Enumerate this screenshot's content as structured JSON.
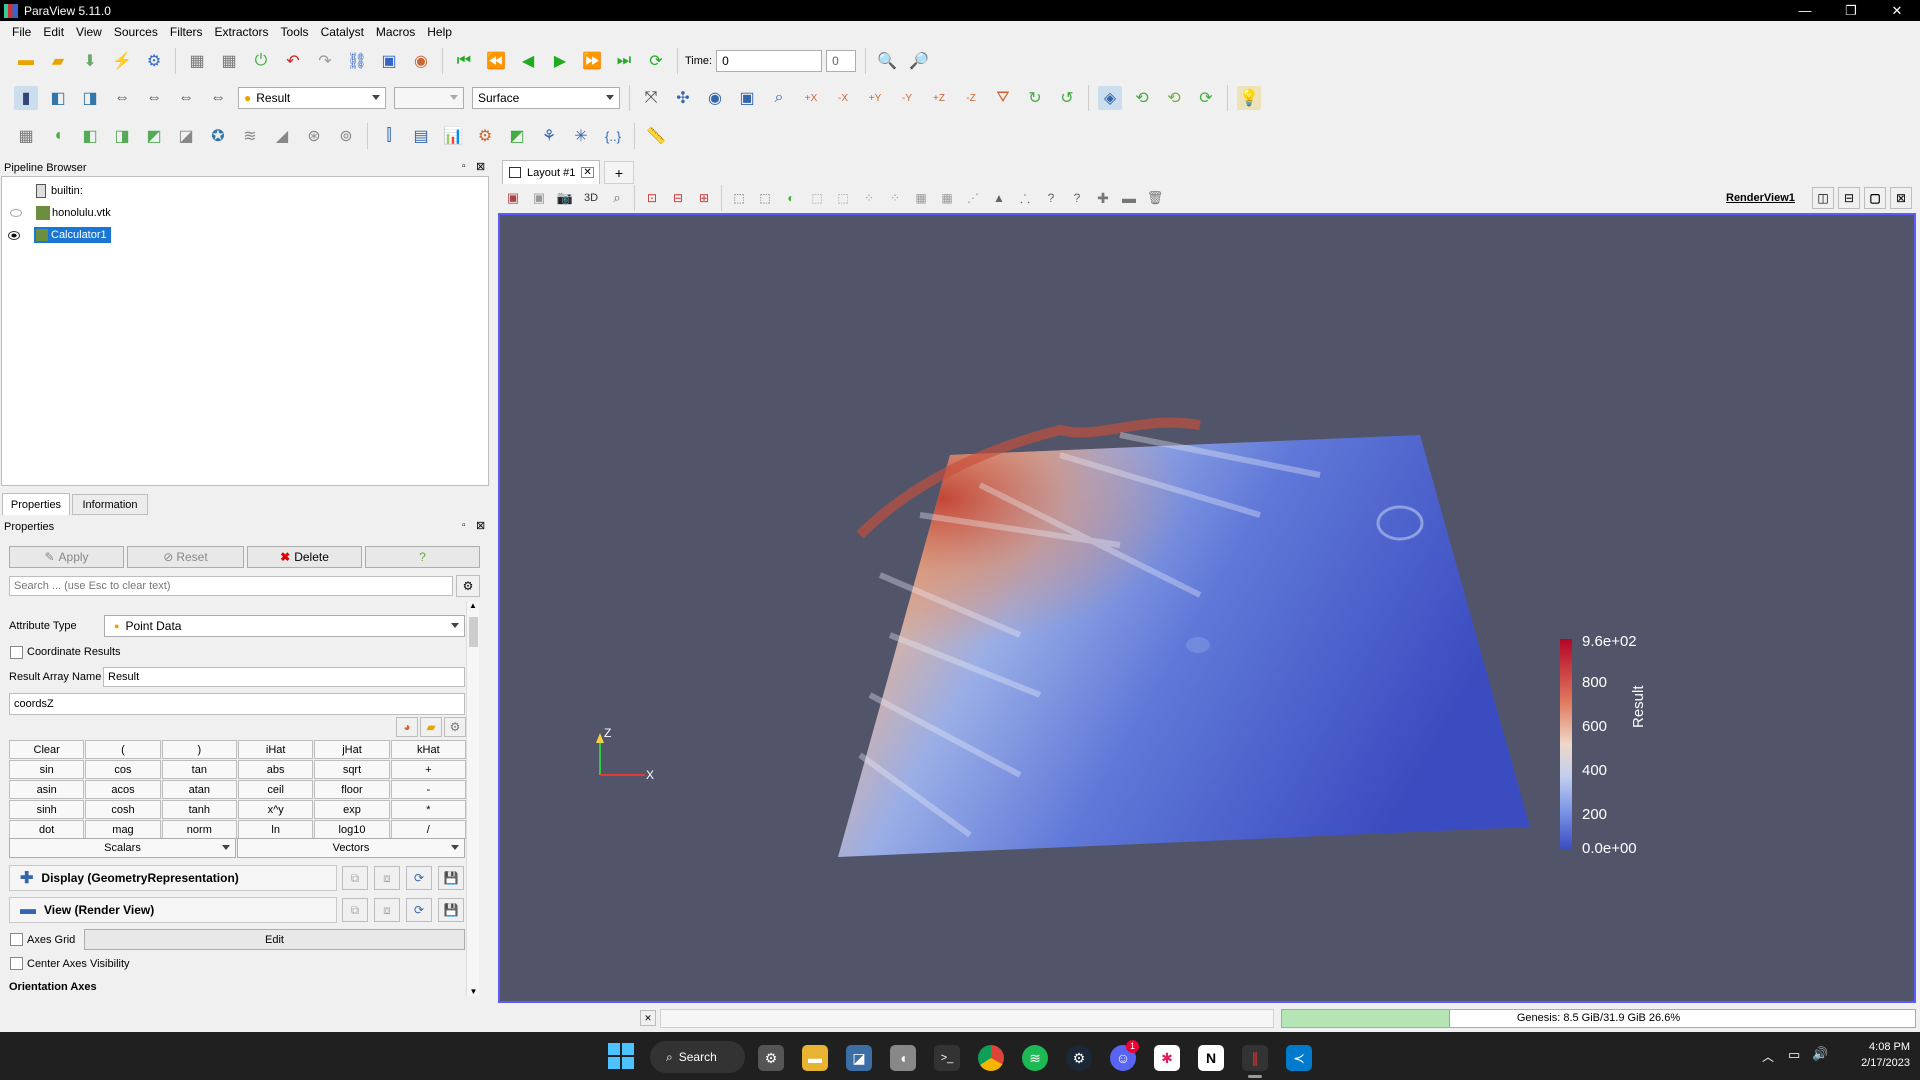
{
  "app": {
    "title": "ParaView 5.11.0"
  },
  "menu": [
    "File",
    "Edit",
    "View",
    "Sources",
    "Filters",
    "Extractors",
    "Tools",
    "Catalyst",
    "Macros",
    "Help"
  ],
  "toolbar1": {
    "time_label": "Time:",
    "time_value": "0",
    "time_index": "0"
  },
  "toolbar2": {
    "color_by": "Result",
    "representation": "Surface"
  },
  "pipeline": {
    "title": "Pipeline Browser",
    "items": [
      "builtin:",
      "honolulu.vtk",
      "Calculator1"
    ]
  },
  "props": {
    "tabs": [
      "Properties",
      "Information"
    ],
    "title": "Properties",
    "apply": "Apply",
    "reset": "Reset",
    "delete": "Delete",
    "help": "?",
    "search_placeholder": "Search ... (use Esc to clear text)",
    "attribute_type_label": "Attribute Type",
    "attribute_type": "Point Data",
    "coordinate_results": "Coordinate Results",
    "result_array_label": "Result Array Name",
    "result_array": "Result",
    "expression": "coordsZ",
    "calc_buttons": [
      "Clear",
      "(",
      ")",
      "iHat",
      "jHat",
      "kHat",
      "sin",
      "cos",
      "tan",
      "abs",
      "sqrt",
      "+",
      "asin",
      "acos",
      "atan",
      "ceil",
      "floor",
      "-",
      "sinh",
      "cosh",
      "tanh",
      "x^y",
      "exp",
      "*",
      "dot",
      "mag",
      "norm",
      "ln",
      "log10",
      "/"
    ],
    "scalars": "Scalars",
    "vectors": "Vectors",
    "display_section": "Display (GeometryRepresentation)",
    "view_section": "View (Render View)",
    "axes_grid": "Axes Grid",
    "edit": "Edit",
    "center_axes": "Center Axes Visibility",
    "orientation_axes": "Orientation Axes"
  },
  "layout": {
    "tab": "Layout #1",
    "add": "+",
    "view_name": "RenderView1",
    "btn_3d": "3D"
  },
  "colorbar": {
    "title": "Result",
    "ticks": [
      "9.6e+02",
      "800",
      "600",
      "400",
      "200",
      "0.0e+00"
    ],
    "top_color": "#b40426",
    "bottom_color": "#3b4cc0"
  },
  "axes": {
    "z": "Z",
    "x": "X"
  },
  "status": {
    "memory": "Genesis: 8.5 GiB/31.9 GiB 26.6%",
    "memory_fraction": 0.266
  },
  "taskbar": {
    "search": "Search",
    "time": "4:08 PM",
    "date": "2/17/2023",
    "discord_badge": "1"
  }
}
